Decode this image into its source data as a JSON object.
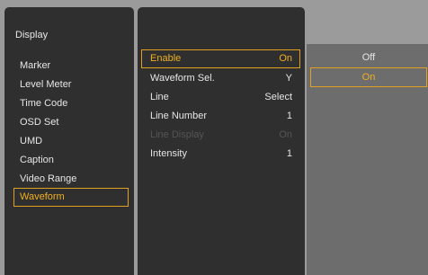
{
  "categories": {
    "title": "Display",
    "items": [
      {
        "label": "Marker"
      },
      {
        "label": "Level Meter"
      },
      {
        "label": "Time Code"
      },
      {
        "label": "OSD Set"
      },
      {
        "label": "UMD"
      },
      {
        "label": "Caption"
      },
      {
        "label": "Video Range"
      },
      {
        "label": "Waveform",
        "selected": true
      }
    ]
  },
  "settings": {
    "rows": [
      {
        "label": "Enable",
        "value": "On",
        "selected": true
      },
      {
        "label": "Waveform Sel.",
        "value": "Y"
      },
      {
        "label": "Line",
        "value": "Select"
      },
      {
        "label": "Line Number",
        "value": "1"
      },
      {
        "label": "Line Display",
        "value": "On",
        "disabled": true
      },
      {
        "label": "Intensity",
        "value": "1"
      }
    ]
  },
  "options": {
    "items": [
      {
        "label": "Off"
      },
      {
        "label": "On",
        "selected": true
      }
    ]
  },
  "colors": {
    "panel_bg": "#2f2f2f",
    "options_bg": "#6d6d6d",
    "background": "#9b9b9b",
    "highlight": "#e0a020",
    "text": "#e6e6e6",
    "disabled_text": "#555555"
  }
}
